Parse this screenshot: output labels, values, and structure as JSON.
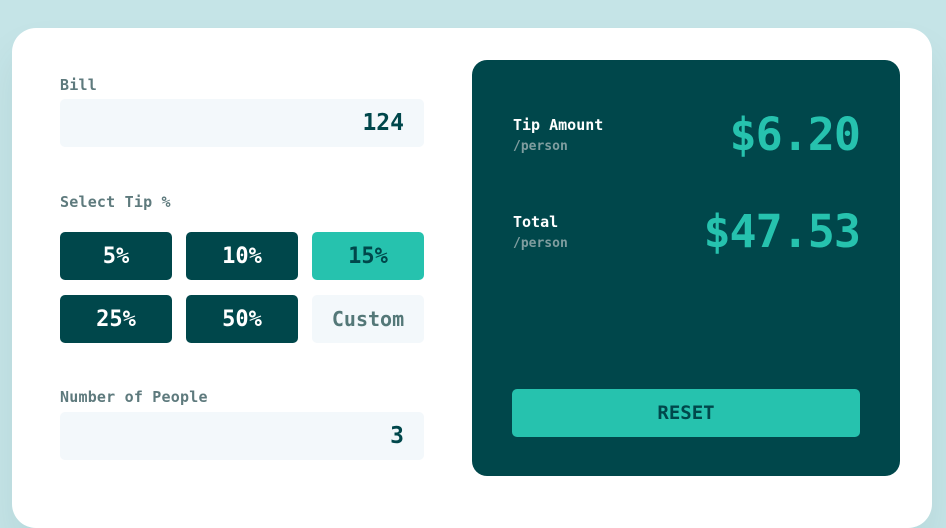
{
  "bill": {
    "label": "Bill",
    "value": "124"
  },
  "tip": {
    "label": "Select Tip %",
    "options": [
      "5%",
      "10%",
      "15%",
      "25%",
      "50%"
    ],
    "selected": "15%",
    "custom_placeholder": "Custom"
  },
  "people": {
    "label": "Number of People",
    "value": "3"
  },
  "results": {
    "tip_amount": {
      "title": "Tip Amount",
      "subtitle": "/person",
      "value": "$6.20"
    },
    "total": {
      "title": "Total",
      "subtitle": "/person",
      "value": "$47.53"
    },
    "reset_label": "RESET"
  },
  "colors": {
    "background": "#c5e4e7",
    "dark_cyan": "#00474b",
    "strong_cyan": "#26c2ae",
    "input_bg": "#f3f8fb"
  }
}
